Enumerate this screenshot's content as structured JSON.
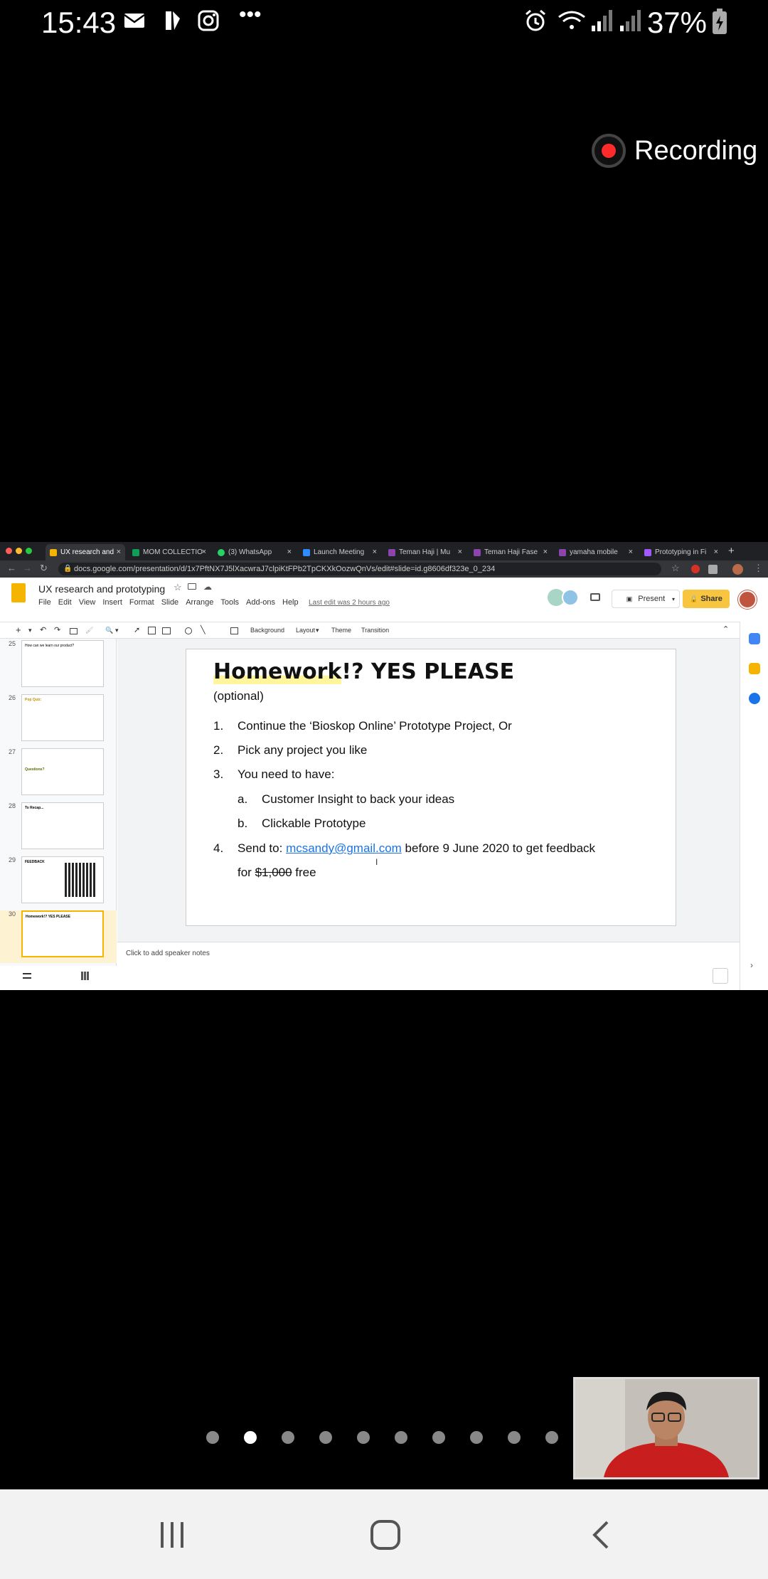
{
  "status": {
    "time": "15:43",
    "battery": "37%",
    "more": "•••"
  },
  "recording": {
    "label": "Recording"
  },
  "browser": {
    "tabs": [
      {
        "label": "UX research and",
        "color": "#f4b400",
        "active": true
      },
      {
        "label": "MOM COLLECTIO",
        "color": "#0f9d58"
      },
      {
        "label": "(3) WhatsApp",
        "color": "#25d366"
      },
      {
        "label": "Launch Meeting",
        "color": "#2d8cff"
      },
      {
        "label": "Teman Haji | Mu",
        "color": "#8e44ad"
      },
      {
        "label": "Teman Haji Fase",
        "color": "#8e44ad"
      },
      {
        "label": "yamaha mobile",
        "color": "#8e44ad"
      },
      {
        "label": "Prototyping in Fi",
        "color": "#a259ff"
      }
    ],
    "url": "docs.google.com/presentation/d/1x7PftNX7J5lXacwraJ7clpiKtFPb2TpCKXkOozwQnVs/edit#slide=id.g8606df323e_0_234"
  },
  "docs": {
    "title": "UX research and prototyping",
    "menu": [
      "File",
      "Edit",
      "View",
      "Insert",
      "Format",
      "Slide",
      "Arrange",
      "Tools",
      "Add-ons",
      "Help"
    ],
    "last_edit": "Last edit was 2 hours ago",
    "present": "Present",
    "share": "Share",
    "toolbar": {
      "background": "Background",
      "layout": "Layout",
      "theme": "Theme",
      "transition": "Transition"
    },
    "notes_placeholder": "Click to add speaker notes"
  },
  "filmstrip": [
    {
      "num": "25",
      "text": "How can we learn our product?"
    },
    {
      "num": "26",
      "text": "Pop Quiz:"
    },
    {
      "num": "27",
      "text": "Questions?"
    },
    {
      "num": "28",
      "text": "To Recap..."
    },
    {
      "num": "29",
      "text": "FEEDBACK"
    },
    {
      "num": "30",
      "text": "Homework!? YES PLEASE"
    }
  ],
  "slide": {
    "title_a": "Homework",
    "title_b": "!? YES PLEASE",
    "subtitle": "(optional)",
    "item1_num": "1.",
    "item1": "Continue the ‘Bioskop Online’ Prototype Project, Or",
    "item2_num": "2.",
    "item2": "Pick any project you like",
    "item3_num": "3.",
    "item3": "You need to have:",
    "item3a_num": "a.",
    "item3a": "Customer Insight to back your ideas",
    "item3b_num": "b.",
    "item3b": "Clickable Prototype",
    "item4_num": "4.",
    "item4_pre": "Send to: ",
    "item4_email": "mcsandy@gmail.com",
    "item4_post": " before 9 June 2020 to get feedback",
    "item4_line2_pre": "for ",
    "item4_price": "$1,000",
    "item4_line2_post": " free"
  }
}
